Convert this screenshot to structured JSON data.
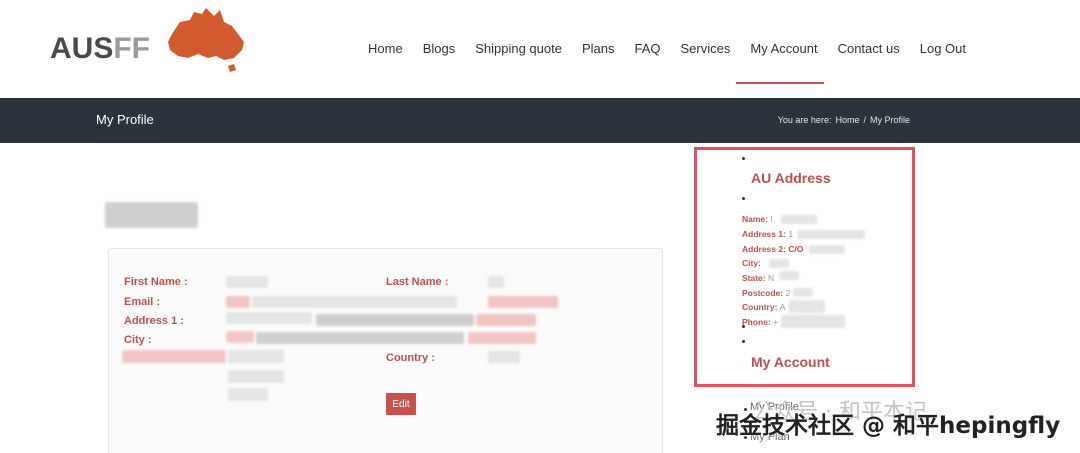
{
  "brand": {
    "name_left": "AUS",
    "name_right": "FF",
    "logo_color": "#d15a2e"
  },
  "nav": {
    "items": [
      "Home",
      "Blogs",
      "Shipping quote",
      "Plans",
      "FAQ",
      "Services",
      "My Account",
      "Contact us",
      "Log Out"
    ],
    "active": "My Account"
  },
  "titlebar": {
    "title": "My Profile",
    "you_are_here": "You are here:",
    "crumb_home": "Home",
    "crumb_sep": "/",
    "crumb_current": "My Profile"
  },
  "profile": {
    "labels": {
      "first_name": "First Name :",
      "last_name": "Last Name :",
      "email": "Email :",
      "address1": "Address 1 :",
      "city": "City :",
      "country": "Country :"
    },
    "edit_label": "Edit"
  },
  "sidebar": {
    "au_address_title": "AU Address",
    "lines": {
      "name": "Name:",
      "address1": "Address 1:",
      "address2": "Address 2: C/O",
      "city": "City:",
      "state": "State:",
      "postcode": "Postcode:",
      "country": "Country:",
      "phone": "Phone:"
    },
    "values": {
      "name": "I",
      "address1": "1",
      "state": "N",
      "postcode": "2",
      "country": "A",
      "phone": "+"
    },
    "my_account_title": "My Account",
    "below_items": [
      "My Profile",
      "My Plan"
    ]
  },
  "watermark": {
    "text": "掘金技术社区 @ 和平hepingfly",
    "ghost": "公众号 · 和平本记"
  },
  "colors": {
    "accent": "#c0504d",
    "titlebar_bg": "#2b333c",
    "highlight_border": "#e5505a"
  }
}
